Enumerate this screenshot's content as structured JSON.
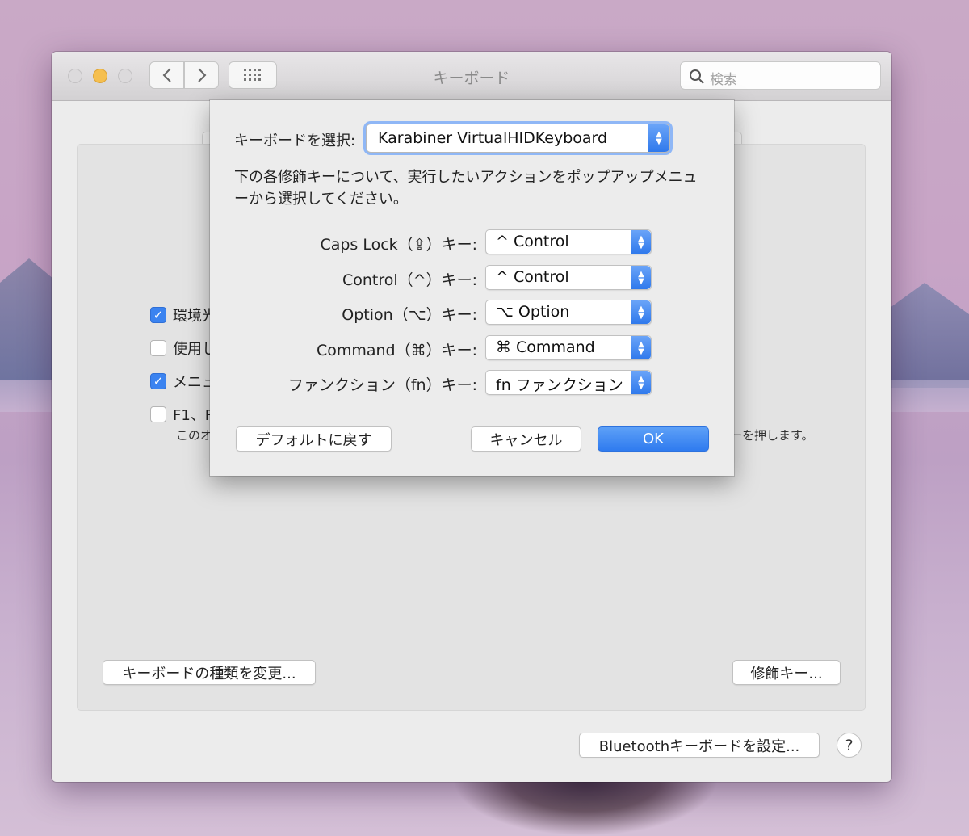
{
  "window": {
    "title": "キーボード",
    "search_placeholder": "検索",
    "nav": {
      "back": "‹",
      "forward": "›",
      "grid": "⋮⋮⋮"
    }
  },
  "background_options": [
    {
      "label": "環境光",
      "checked": true
    },
    {
      "label": "使用し",
      "checked": false
    },
    {
      "label": "メニュ",
      "checked": true
    },
    {
      "label": "F1、F",
      "checked": false
    }
  ],
  "background_note_left": "このオ",
  "background_note_right": "ーを押します。",
  "buttons": {
    "change_type": "キーボードの種類を変更...",
    "modifier_keys": "修飾キー...",
    "bluetooth": "Bluetoothキーボードを設定...",
    "help": "?"
  },
  "sheet": {
    "keyboard_label": "キーボードを選択:",
    "keyboard_value": "Karabiner VirtualHIDKeyboard",
    "description": "下の各修飾キーについて、実行したいアクションをポップアップメニューから選択してください。",
    "modifiers": [
      {
        "label": "Caps Lock（⇪）キー:",
        "value": "^ Control"
      },
      {
        "label": "Control（^）キー:",
        "value": "^ Control"
      },
      {
        "label": "Option（⌥）キー:",
        "value": "⌥ Option"
      },
      {
        "label": "Command（⌘）キー:",
        "value": "⌘ Command"
      },
      {
        "label": "ファンクション（fn）キー:",
        "value": "fn ファンクション"
      }
    ],
    "restore_defaults": "デフォルトに戻す",
    "cancel": "キャンセル",
    "ok": "OK"
  },
  "colors": {
    "accent": "#3b83f0",
    "traffic_min": "#f5bf4f"
  }
}
